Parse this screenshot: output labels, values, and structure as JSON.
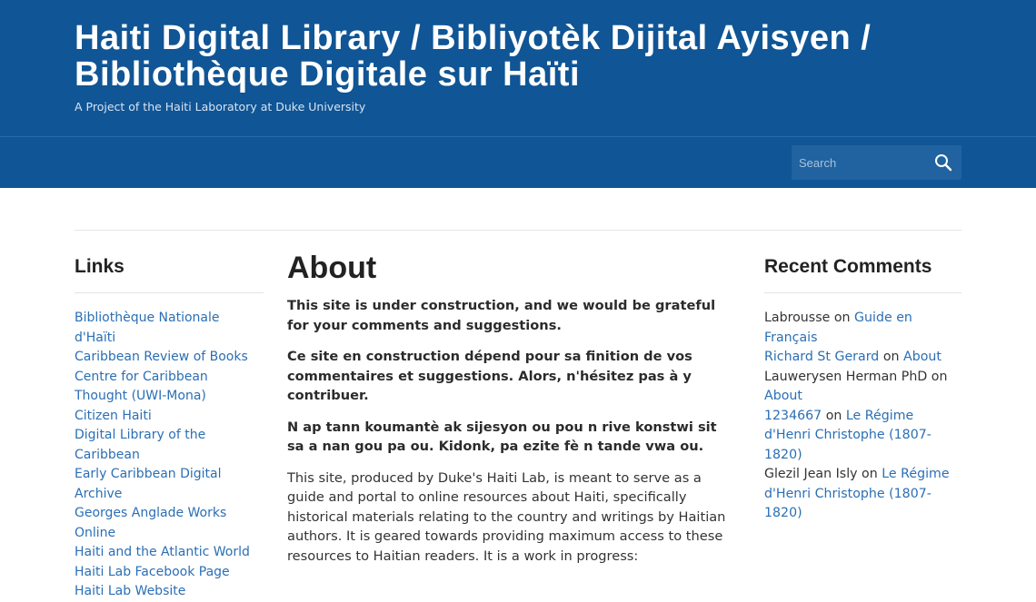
{
  "header": {
    "title": "Haiti Digital Library / Bibliyotèk Dijital Ayisyen / Bibliothèque Digitale sur Haïti",
    "tagline": "A Project of the Haiti Laboratory at Duke University"
  },
  "search": {
    "placeholder": "Search",
    "icon": "search-icon"
  },
  "links": {
    "title": "Links",
    "items": [
      "Bibliothèque Nationale d'Haïti",
      "Caribbean Review of Books",
      "Centre for Caribbean Thought (UWI-Mona)",
      "Citizen Haiti",
      "Digital Library of the Caribbean",
      "Early Caribbean Digital Archive",
      "Georges Anglade Works Online",
      "Haiti and the Atlantic World",
      "Haiti Lab Facebook Page",
      "Haiti Lab Website"
    ]
  },
  "main": {
    "title": "About",
    "p1": "This site is under construction, and we would be grateful for your comments and suggestions.",
    "p2": "Ce site en construction dépend pour sa finition de vos commentaires et suggestions. Alors, n'hésitez pas à y contribuer.",
    "p3": "N ap tann koumantè ak sijesyon ou pou n rive konstwi sit sa a nan gou pa ou. Kidonk, pa ezite fè n tande vwa ou.",
    "p4": "This site, produced by Duke's Haiti Lab, is meant to serve as a guide and portal to online resources about Haiti, specifically historical materials relating to the country and writings by Haitian authors. It is geared towards providing maximum access to these resources to Haitian readers. It is a work in progress:"
  },
  "comments": {
    "title": "Recent Comments",
    "on": "on",
    "items": [
      {
        "author": "Labrousse",
        "author_link": false,
        "post": "Guide en Français"
      },
      {
        "author": "Richard St Gerard",
        "author_link": true,
        "post": "About"
      },
      {
        "author": "Lauwerysen Herman PhD",
        "author_link": false,
        "post": "About"
      },
      {
        "author": "1234667",
        "author_link": true,
        "post": "Le Régime d'Henri Christophe (1807-1820)"
      },
      {
        "author": "Glezil Jean Isly",
        "author_link": false,
        "post": "Le Régime d'Henri Christophe (1807-1820)"
      }
    ]
  },
  "colors": {
    "header_bg": "#105595",
    "link": "#2a6fb5"
  }
}
